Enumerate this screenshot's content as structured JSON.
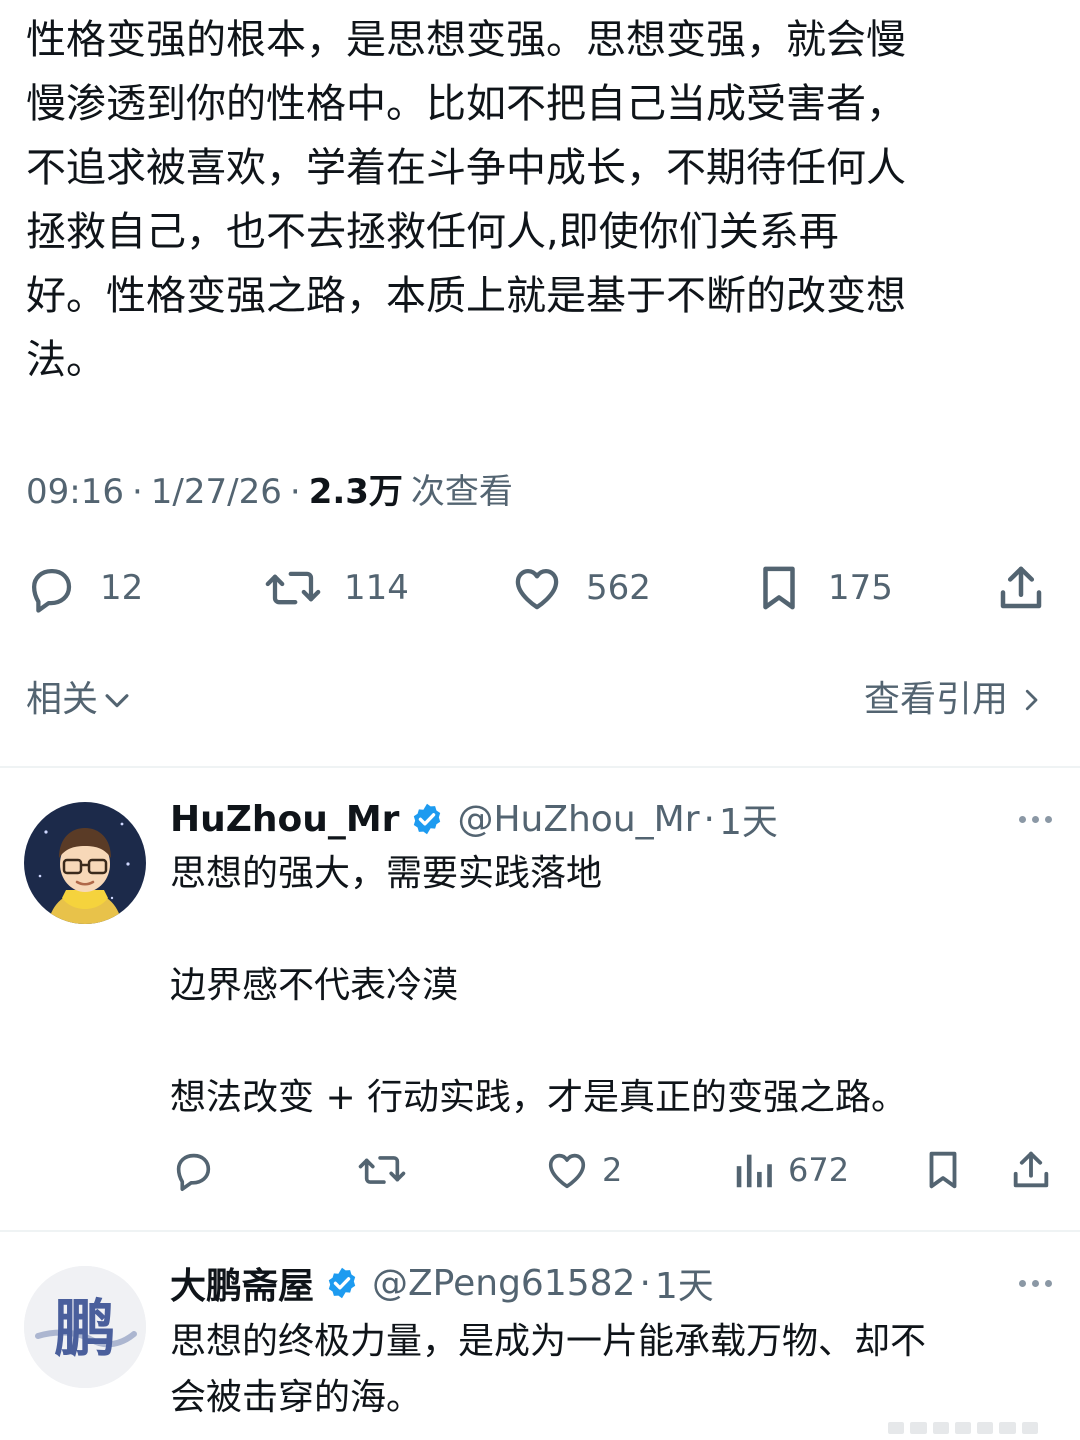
{
  "post": {
    "text": "性格变强的根本，是思想变强。思想变强，就会慢\n慢渗透到你的性格中。比如不把自己当成受害者，\n不追求被喜欢，学着在斗争中成长，不期待任何人\n拯救自己，也不去拯救任何人,即使你们关系再\n好。性格变强之路，本质上就是基于不断的改变想\n法。",
    "time": "09:16",
    "date": "1/27/26",
    "views_count": "2.3万",
    "views_label": "次查看",
    "separator": "·",
    "actions": {
      "reply_count": "12",
      "retweet_count": "114",
      "like_count": "562",
      "bookmark_count": "175"
    },
    "related_label": "相关",
    "quotes_label": "查看引用"
  },
  "replies": [
    {
      "name": "HuZhou_Mr",
      "handle": "@HuZhou_Mr",
      "time": "1天",
      "separator": "·",
      "body": "思想的强大，需要实践落地\n\n边界感不代表冷漠\n\n想法改变 + 行动实践，才是真正的变强之路。",
      "like_count": "2",
      "view_count": "672"
    },
    {
      "name": "大鹏斋屋",
      "handle": "@ZPeng61582",
      "time": "1天",
      "separator": "·",
      "body": "思想的终极力量，是成为一片能承载万物、却不\n会被击穿的海。",
      "avatar_glyph": "鹏"
    }
  ],
  "colors": {
    "text": "#0f1419",
    "secondary": "#536471",
    "verified": "#1d9bf0",
    "divider": "#eff3f4"
  }
}
